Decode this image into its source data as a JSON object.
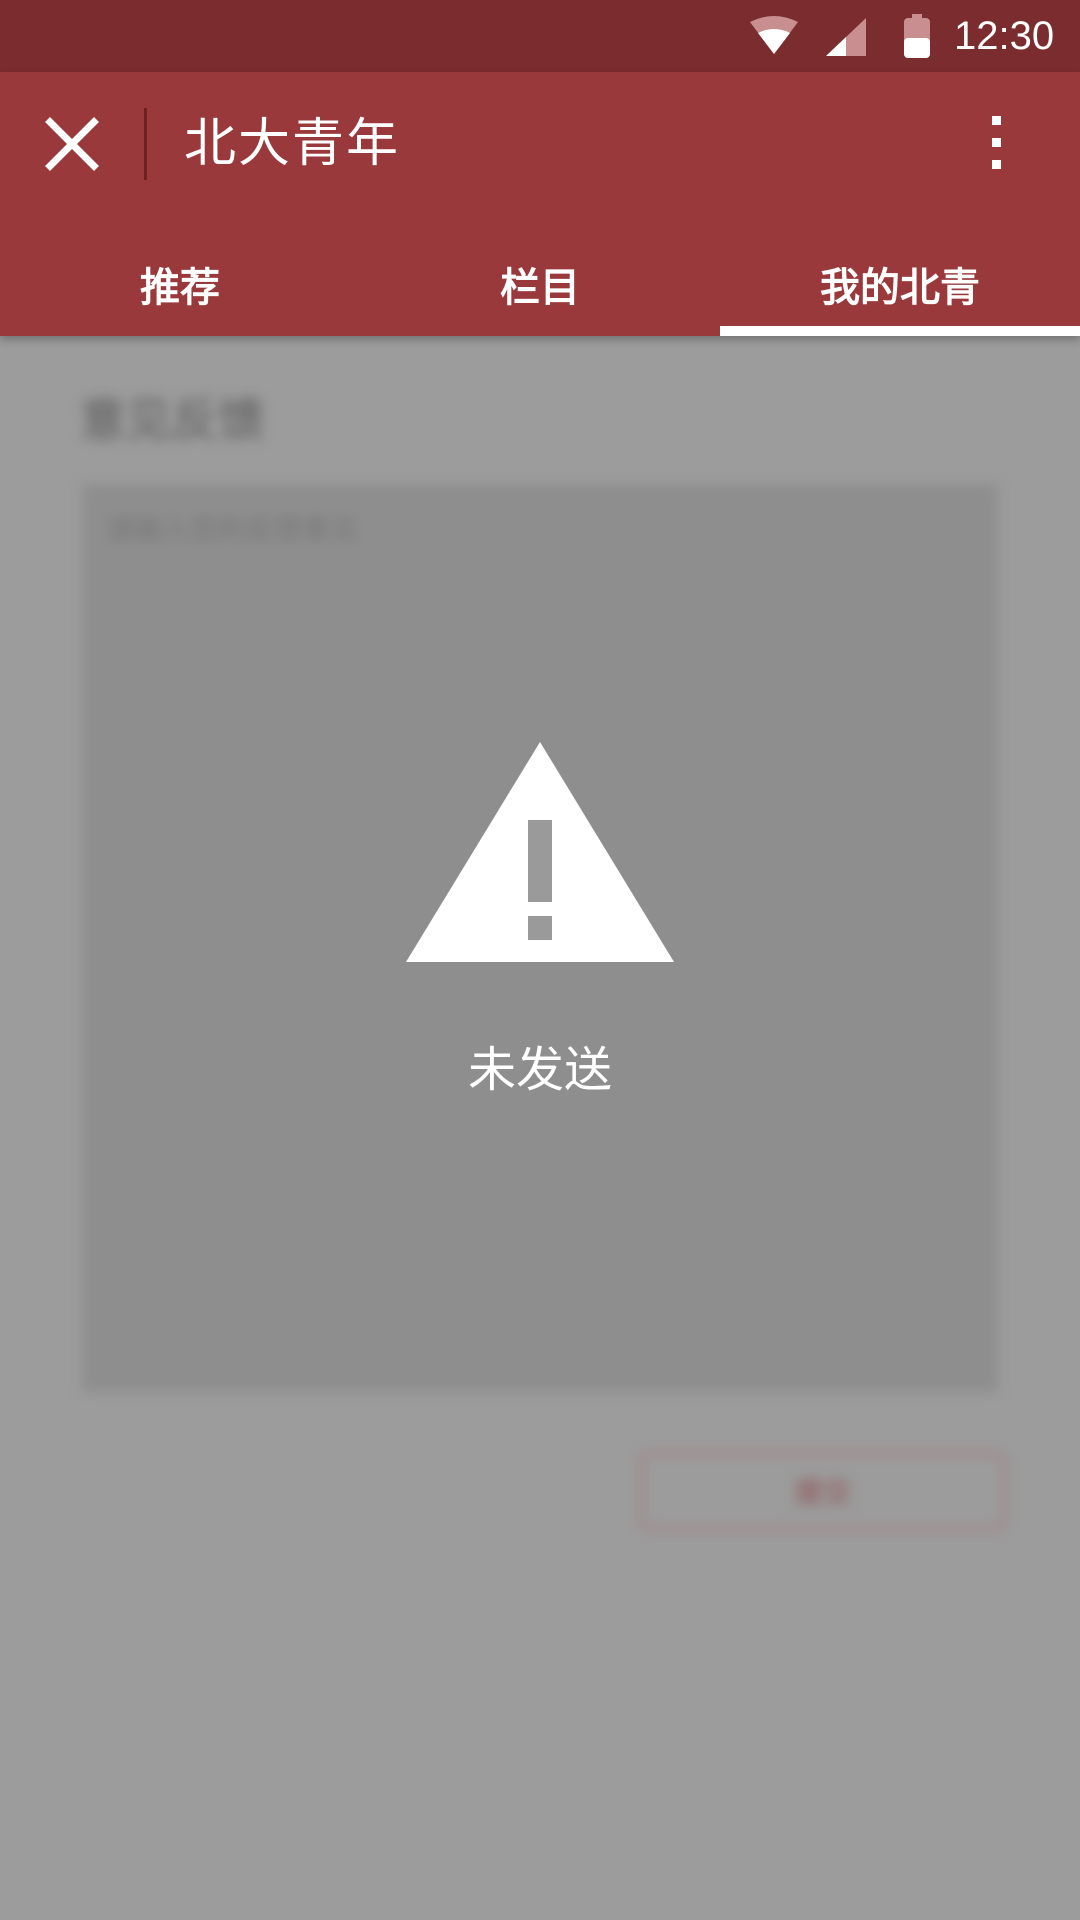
{
  "status_bar": {
    "time": "12:30",
    "icons": [
      "wifi-icon",
      "cellular-signal-icon",
      "battery-icon"
    ],
    "background": "#7a2c2e"
  },
  "app_bar": {
    "title": "北大青年",
    "close_icon": "close-icon",
    "more_icon": "more-vertical-icon",
    "background": "#99393b"
  },
  "tabs": [
    {
      "label": "推荐",
      "active": false
    },
    {
      "label": "栏目",
      "active": false
    },
    {
      "label": "我的北青",
      "active": true
    }
  ],
  "content": {
    "section_title": "意见反馈",
    "feedback_placeholder": "请输入您的反馈意见",
    "submit_label": "提交"
  },
  "toast": {
    "icon": "warning-icon",
    "message": "未发送"
  }
}
